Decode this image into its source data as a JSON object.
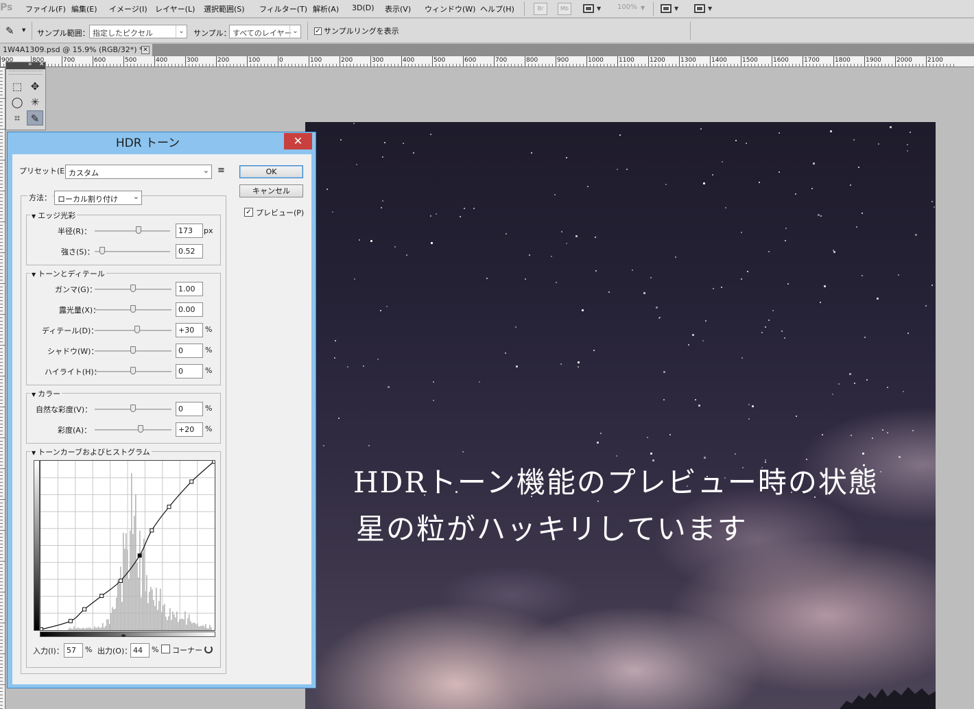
{
  "menubar": {
    "logo": "Ps",
    "items": [
      "ファイル(F)",
      "編集(E)",
      "イメージ(I)",
      "レイヤー(L)",
      "選択範囲(S)",
      "フィルター(T)",
      "解析(A)",
      "3D(D)",
      "表示(V)",
      "ウィンドウ(W)",
      "ヘルプ(H)"
    ],
    "br_label": "Br",
    "mb_label": "Mb",
    "zoom": "100%"
  },
  "options": {
    "sample_size_label": "サンプル範囲：",
    "sample_size_value": "指定したピクセル",
    "sample_label": "サンプル：",
    "sample_value": "すべてのレイヤー",
    "show_ring_label": "サンプルリングを表示",
    "show_ring_checked": true
  },
  "document": {
    "tab_title": "1W4A1309.psd @ 15.9% (RGB/32*) *",
    "close_glyph": "✕",
    "ruler_labels": [
      "900",
      "800",
      "700",
      "600",
      "500",
      "400",
      "300",
      "200",
      "100",
      "0",
      "100",
      "200",
      "300",
      "400",
      "500",
      "600",
      "700",
      "800",
      "900",
      "1000",
      "1100",
      "1200",
      "1300",
      "1400",
      "1500",
      "1600",
      "1700",
      "1800",
      "1900",
      "2000",
      "2100"
    ]
  },
  "tools": {
    "collapse_glyph": "»",
    "close_glyph": "✕",
    "items": [
      {
        "name": "marquee-tool-icon",
        "glyph": "⬚"
      },
      {
        "name": "move-tool-icon",
        "glyph": "✥"
      },
      {
        "name": "lasso-tool-icon",
        "glyph": "◯"
      },
      {
        "name": "magic-wand-tool-icon",
        "glyph": "✳"
      },
      {
        "name": "crop-tool-icon",
        "glyph": "⌗"
      },
      {
        "name": "eyedropper-tool-icon",
        "glyph": "✎"
      }
    ]
  },
  "photo": {
    "caption_line1": "HDRトーン機能のプレビュー時の状態",
    "caption_line2": "星の粒がハッキリしています"
  },
  "dialog": {
    "title": "HDR トーン",
    "close_glyph": "✕",
    "preset_label": "プリセット(E)：",
    "preset_value": "カスタム",
    "preset_menu_glyph": "≡",
    "ok_label": "OK",
    "cancel_label": "キャンセル",
    "preview_label": "プレビュー(P)",
    "preview_checked": true,
    "method_label": "方法：",
    "method_value": "ローカル割り付け",
    "edge_glow": {
      "title": "エッジ光彩",
      "radius_label": "半径(R)：",
      "radius_value": "173",
      "radius_unit": "px",
      "radius_fraction": 0.57,
      "strength_label": "強さ(S)：",
      "strength_value": "0.52",
      "strength_fraction": 0.1
    },
    "tone_detail": {
      "title": "トーンとディテール",
      "gamma_label": "ガンマ(G)：",
      "gamma_value": "1.00",
      "gamma_fraction": 0.5,
      "exposure_label": "露光量(X)：",
      "exposure_value": "0.00",
      "exposure_fraction": 0.5,
      "detail_label": "ディテール(D)：",
      "detail_value": "+30",
      "detail_fraction": 0.55,
      "shadow_label": "シャドウ(W)：",
      "shadow_value": "0",
      "shadow_fraction": 0.5,
      "highlight_label": "ハイライト(H)：",
      "highlight_value": "0",
      "highlight_fraction": 0.5,
      "percent": "%"
    },
    "color": {
      "title": "カラー",
      "vibrance_label": "自然な彩度(V)：",
      "vibrance_value": "0",
      "vibrance_fraction": 0.5,
      "saturation_label": "彩度(A)：",
      "saturation_value": "+20",
      "saturation_fraction": 0.6,
      "percent": "%"
    },
    "curve": {
      "title": "トーンカーブおよびヒストグラム",
      "input_label": "入力(I)：",
      "input_value": "57",
      "output_label": "出力(O)：",
      "output_value": "44",
      "percent": "%",
      "corner_label": "コーナー",
      "corner_checked": false,
      "points": [
        [
          0,
          0
        ],
        [
          17,
          5
        ],
        [
          25,
          12
        ],
        [
          35,
          20
        ],
        [
          46,
          29
        ],
        [
          57,
          44
        ],
        [
          64,
          59
        ],
        [
          74,
          73
        ],
        [
          87,
          88
        ],
        [
          100,
          100
        ]
      ],
      "selected_point": 5
    }
  },
  "colors": {
    "dialog_frame": "#8cc4ef",
    "close_button": "#c9413f",
    "sky_dark": "#1e1b2b"
  }
}
